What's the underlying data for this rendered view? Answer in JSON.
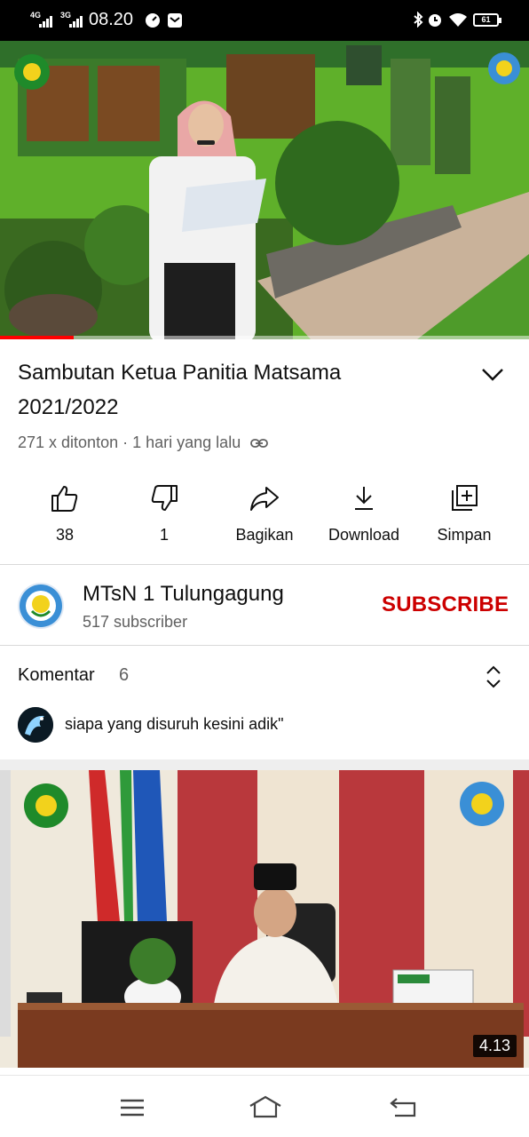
{
  "status_bar": {
    "network_1": "4G",
    "network_2": "3G",
    "time": "08.20",
    "battery": "61"
  },
  "video": {
    "title": "Sambutan Ketua Panitia Matsama 2021/2022",
    "views": "271 x ditonton",
    "separator": "·",
    "uploaded": "1 hari yang lalu",
    "progress_fraction": 0.14
  },
  "actions": {
    "like_count": "38",
    "dislike_count": "1",
    "share_label": "Bagikan",
    "download_label": "Download",
    "save_label": "Simpan"
  },
  "channel": {
    "name": "MTsN 1 Tulungagung",
    "subscribers": "517 subscriber",
    "subscribe_label": "SUBSCRIBE",
    "subscribe_color": "#cc0000"
  },
  "comments": {
    "label": "Komentar",
    "count": "6",
    "top_comment": "siapa yang disuruh kesini adik\""
  },
  "next_video": {
    "duration": "4.13"
  },
  "icons": {
    "like": "thumbs-up-icon",
    "dislike": "thumbs-down-icon",
    "share": "share-arrow-icon",
    "download": "download-icon",
    "save": "add-to-playlist-icon",
    "expand": "chevron-down-icon",
    "comments_toggle": "unfold-icon",
    "link": "link-icon",
    "nav_menu": "menu-icon",
    "nav_home": "home-icon",
    "nav_back": "back-icon"
  }
}
